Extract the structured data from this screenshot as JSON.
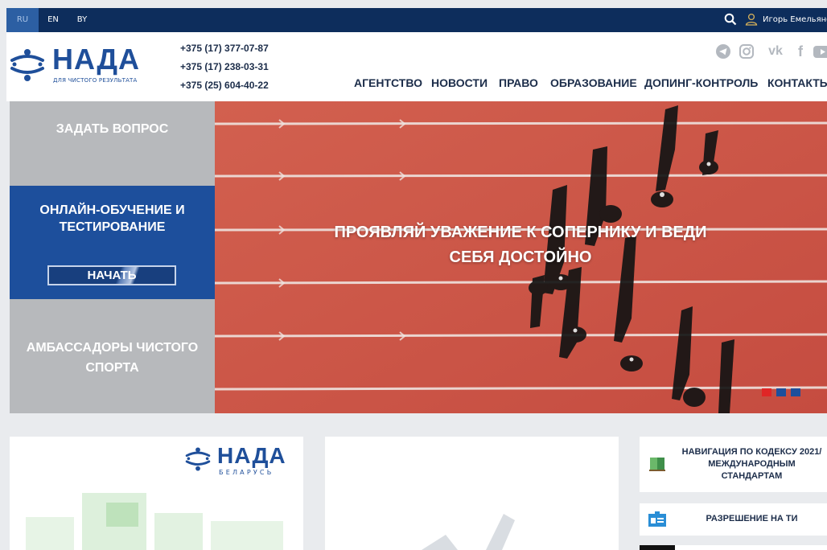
{
  "topbar": {
    "languages": [
      {
        "code": "RU",
        "active": true
      },
      {
        "code": "EN",
        "active": false
      },
      {
        "code": "BY",
        "active": false
      }
    ],
    "search_icon": "search-icon",
    "user_icon": "user-icon",
    "user_name": "Игорь Емельянов"
  },
  "header": {
    "logo_name": "НАДА",
    "logo_tagline": "ДЛЯ ЧИСТОГО РЕЗУЛЬТАТА",
    "phones": [
      "+375 (17) 377-07-87",
      "+375 (17) 238-03-31",
      "+375 (25) 604-40-22"
    ],
    "socials": [
      "telegram-icon",
      "instagram-icon",
      "vk-icon",
      "facebook-icon",
      "youtube-icon"
    ],
    "nav": [
      "АГЕНТСТВО",
      "НОВОСТИ",
      "ПРАВО",
      "ОБРАЗОВАНИЕ",
      "ДОПИНГ-КОНТРОЛЬ",
      "КОНТАКТЫ"
    ]
  },
  "side_panels": {
    "ask": "ЗАДАТЬ ВОПРОС",
    "online_title": "ОНЛАЙН-ОБУЧЕНИЕ И ТЕСТИРОВАНИЕ",
    "start_button": "НАЧАТЬ",
    "ambassadors": "АМБАССАДОРЫ ЧИСТОГО СПОРТА"
  },
  "hero": {
    "caption": "ПРОЯВЛЯЙ УВАЖЕНИЕ К СОПЕРНИКУ И ВЕДИ СЕБЯ ДОСТОЙНО",
    "slides": [
      {
        "color": "#e02626",
        "active": true
      },
      {
        "color": "#1d4f9c",
        "active": false
      },
      {
        "color": "#1d4f9c",
        "active": false
      }
    ],
    "track_color": "#d0584a"
  },
  "cards": {
    "map_logo_name": "НАДА",
    "map_logo_country": "БЕЛАРУСЬ"
  },
  "links": {
    "code_nav": "НАВИГАЦИЯ ПО КОДЕКСУ 2021/МЕЖДУНАРОДНЫМ СТАНДАРТАМ",
    "ti_permit": "РАЗРЕШЕНИЕ НА ТИ"
  },
  "colors": {
    "brand_navy": "#0d2d5c",
    "brand_blue": "#1f4f9a",
    "panel_gray": "#b7b9bc"
  }
}
